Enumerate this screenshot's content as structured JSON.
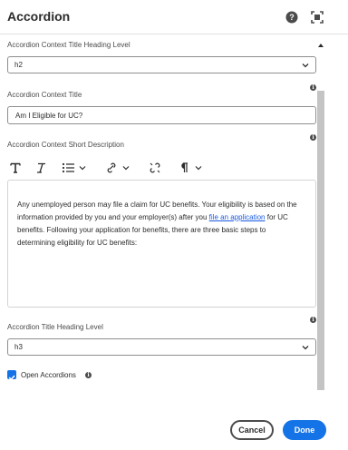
{
  "dialog": {
    "title": "Accordion"
  },
  "fields": {
    "context_heading_label": "Accordion Context Title Heading Level",
    "context_heading_value": "h2",
    "context_title_label": "Accordion Context Title",
    "context_title_value": "Am I Eligible for UC?",
    "short_description_label": "Accordion Context Short Description",
    "title_heading_label": "Accordion Title Heading Level",
    "title_heading_value": "h3",
    "open_accordions_label": "Open Accordions",
    "open_accordions_checked": true
  },
  "editor": {
    "text_before_link": "Any unemployed person may file a claim for UC benefits. Your eligibility is based on the information provided by you and your employer(s) after you ",
    "link_text": "file an application",
    "text_after_link": " for UC benefits. Following your application for benefits, there are three basic steps to determining eligibility for UC benefits:"
  },
  "toolbar": {
    "icons": [
      "bold-icon",
      "italic-icon",
      "list-icon",
      "link-icon",
      "unlink-icon",
      "paragraph-icon"
    ]
  },
  "footer": {
    "cancel_label": "Cancel",
    "done_label": "Done"
  },
  "colors": {
    "accent": "#1473e6",
    "link": "#1a5ae0",
    "text": "#2c2c2c"
  }
}
